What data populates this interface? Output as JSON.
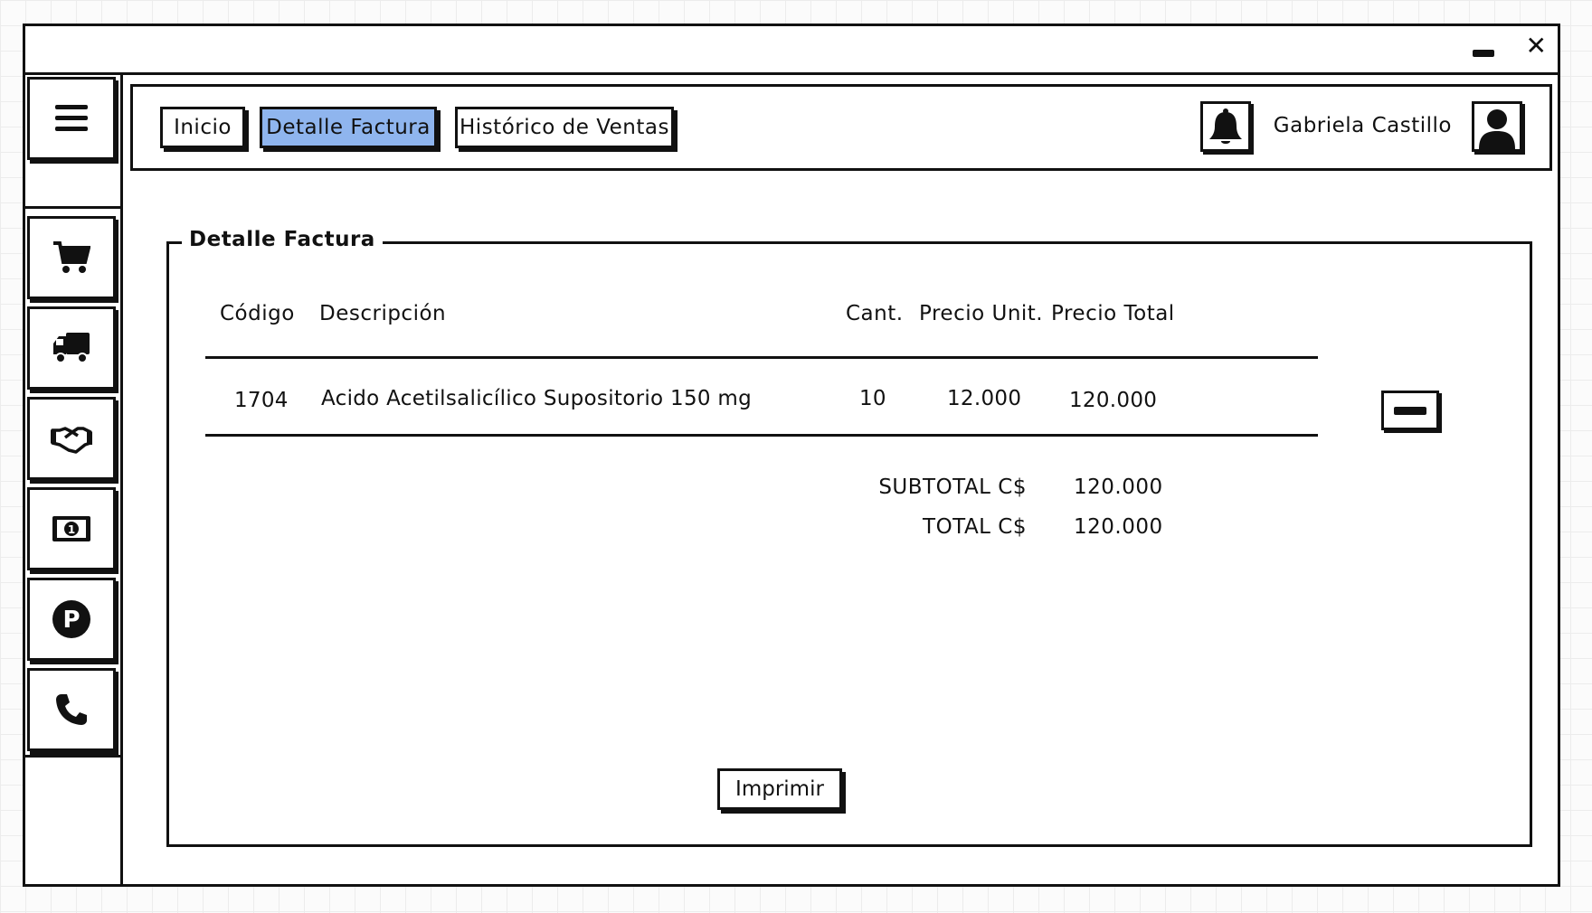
{
  "window": {
    "minimize_icon": "minimize-icon",
    "close_glyph": "✕"
  },
  "sidebar": {
    "items": [
      {
        "id": "menu",
        "icon": "hamburger-menu-icon"
      },
      {
        "id": "sales",
        "icon": "shopping-cart-icon"
      },
      {
        "id": "delivery",
        "icon": "truck-icon"
      },
      {
        "id": "clients",
        "icon": "handshake-icon"
      },
      {
        "id": "cash",
        "icon": "money-bill-icon"
      },
      {
        "id": "parking",
        "icon": "parking-icon"
      },
      {
        "id": "contact",
        "icon": "phone-icon"
      }
    ]
  },
  "header": {
    "tabs": [
      {
        "label": "Inicio",
        "active": false
      },
      {
        "label": "Detalle Factura",
        "active": true
      },
      {
        "label": "Histórico de Ventas",
        "active": false
      }
    ],
    "notifications_icon": "bell-icon",
    "user_name": "Gabriela Castillo",
    "avatar_icon": "user-avatar-icon"
  },
  "invoice": {
    "legend": "Detalle Factura",
    "columns": {
      "code": "Código",
      "description": "Descripción",
      "qty": "Cant.",
      "unit_price": "Precio Unit.",
      "total_price": "Precio Total"
    },
    "rows": [
      {
        "code": "1704",
        "description": "Acido Acetilsalicílico Supositorio 150 mg",
        "qty": "10",
        "unit_price": "12.000",
        "total_price": "120.000"
      }
    ],
    "subtotal_label": "SUBTOTAL C$",
    "subtotal_value": "120.000",
    "total_label": "TOTAL C$",
    "total_value": "120.000",
    "print_label": "Imprimir"
  },
  "colors": {
    "active_tab": "#8fb5ee",
    "ink": "#111111"
  }
}
